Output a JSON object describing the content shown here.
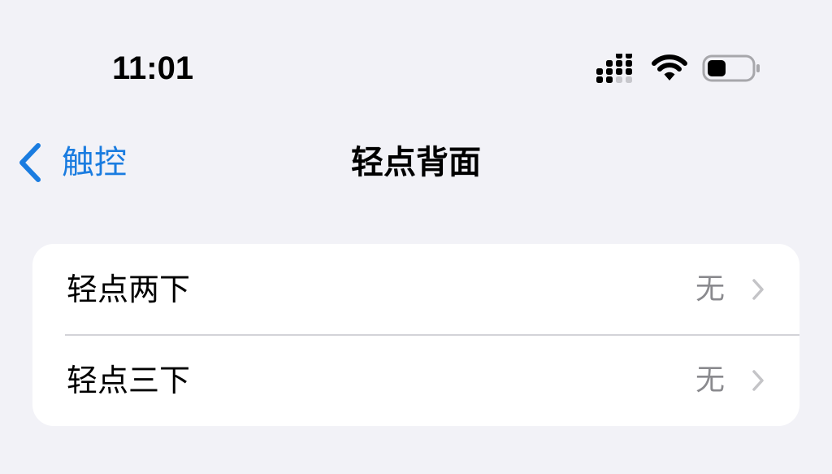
{
  "status_bar": {
    "time": "11:01",
    "icons": [
      "signal-icon",
      "wifi-icon",
      "battery-icon"
    ]
  },
  "nav": {
    "back_label": "触控",
    "title": "轻点背面"
  },
  "settings": {
    "rows": [
      {
        "label": "轻点两下",
        "value": "无"
      },
      {
        "label": "轻点三下",
        "value": "无"
      }
    ]
  },
  "colors": {
    "background": "#f2f2f7",
    "accent": "#1a7ce0",
    "secondary_text": "#8a8a8e"
  }
}
